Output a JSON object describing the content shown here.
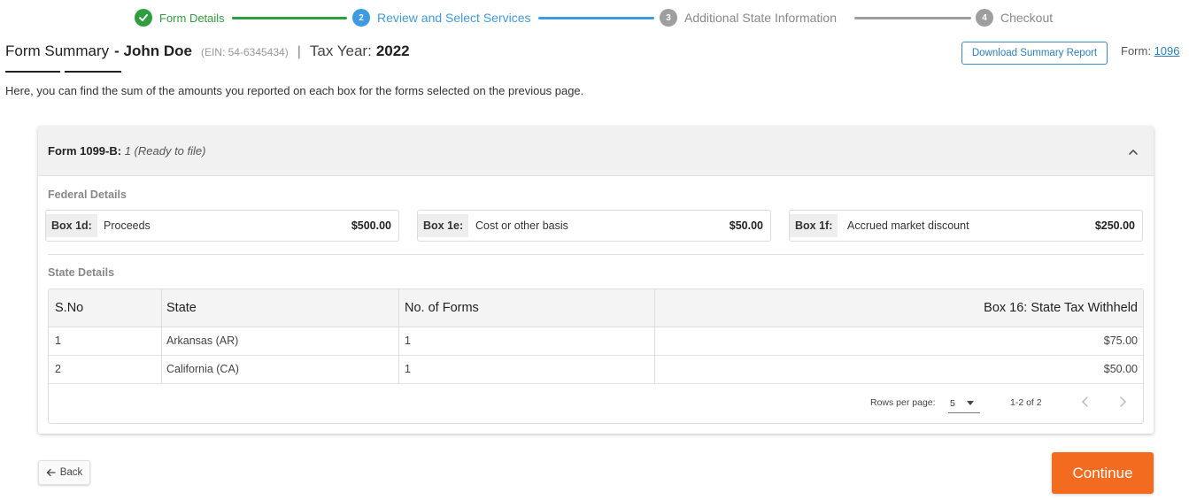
{
  "stepper": {
    "steps": [
      {
        "number": "1",
        "label": "Form Details",
        "status": "completed"
      },
      {
        "number": "2",
        "label": "Review and Select Services",
        "status": "active"
      },
      {
        "number": "3",
        "label": "Additional State Information",
        "status": "pending"
      },
      {
        "number": "4",
        "label": "Checkout",
        "status": "pending"
      }
    ]
  },
  "header": {
    "title": "Form Summary",
    "name": "- John Doe",
    "ein": "(EIN: 54-6345434)",
    "separator": "|",
    "tax_year_label": "Tax Year:",
    "tax_year": "2022",
    "download_button": "Download Summary Report",
    "form_label": "Form:",
    "form_link": "1096"
  },
  "description": "Here, you can find the sum of the amounts you reported on each box for the forms selected on the previous page.",
  "card": {
    "form_name": "Form 1099-B:",
    "form_status": "1 (Ready to file)",
    "federal_label": "Federal Details",
    "federal_boxes": [
      {
        "tag": "Box 1d:",
        "desc": "Proceeds",
        "value": "$500.00"
      },
      {
        "tag": "Box 1e:",
        "desc": "Cost or other basis",
        "value": "$50.00"
      },
      {
        "tag": "Box 1f:",
        "desc": "Accrued market discount",
        "value": "$250.00"
      }
    ],
    "state_label": "State Details",
    "table": {
      "headers": [
        "S.No",
        "State",
        "No. of Forms",
        "Box 16: State Tax Withheld"
      ],
      "rows": [
        [
          "1",
          "Arkansas (AR)",
          "1",
          "$75.00"
        ],
        [
          "2",
          "California (CA)",
          "1",
          "$50.00"
        ]
      ]
    },
    "pagination": {
      "rows_per_page_label": "Rows per page:",
      "rows_per_page": "5",
      "range": "1-2 of 2"
    }
  },
  "footer": {
    "back": "Back",
    "continue": "Continue"
  },
  "colors": {
    "completed": "#2e9e3e",
    "active": "#3d9be3",
    "pending": "#9e9e9e",
    "continue": "#f26b1f",
    "link": "#2a7fbf"
  }
}
